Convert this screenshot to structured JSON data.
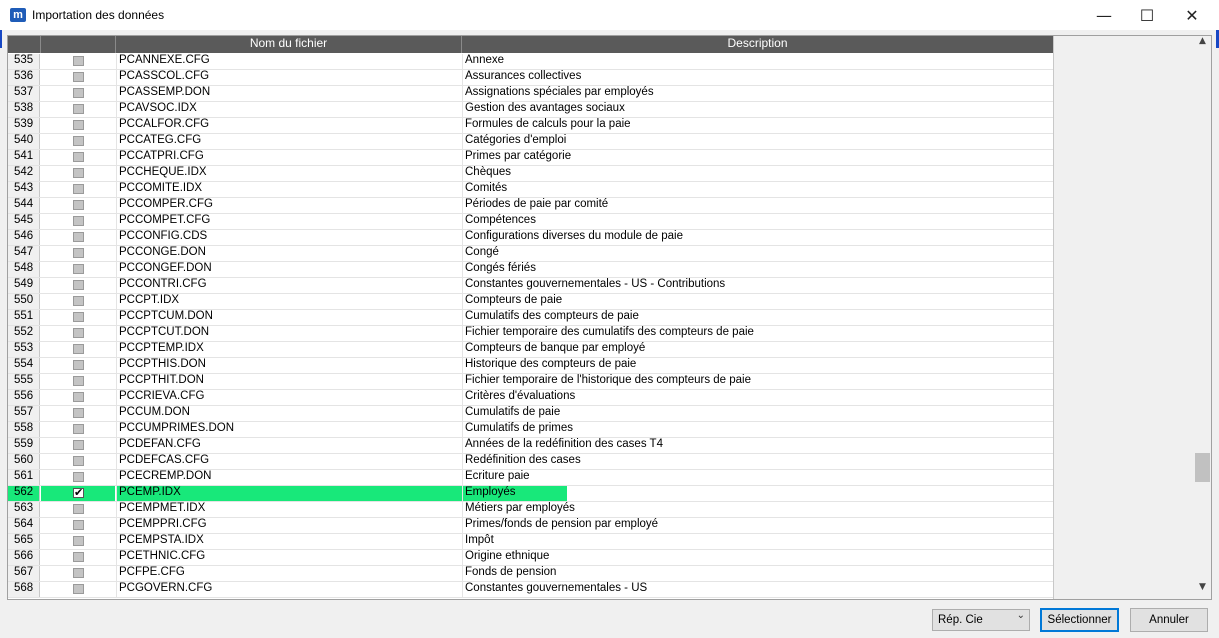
{
  "window": {
    "title": "Importation des données",
    "app_icon_letter": "m",
    "minimize": "—",
    "maximize": "☐",
    "close": "✕"
  },
  "grid": {
    "columns": {
      "filename": "Nom du fichier",
      "description": "Description"
    },
    "rows": [
      {
        "num": "535",
        "checked": false,
        "file": "PCANNEXE.CFG",
        "desc": "Annexe"
      },
      {
        "num": "536",
        "checked": false,
        "file": "PCASSCOL.CFG",
        "desc": "Assurances collectives"
      },
      {
        "num": "537",
        "checked": false,
        "file": "PCASSEMP.DON",
        "desc": "Assignations spéciales par employés"
      },
      {
        "num": "538",
        "checked": false,
        "file": "PCAVSOC.IDX",
        "desc": "Gestion des avantages sociaux"
      },
      {
        "num": "539",
        "checked": false,
        "file": "PCCALFOR.CFG",
        "desc": "Formules de calculs pour la paie"
      },
      {
        "num": "540",
        "checked": false,
        "file": "PCCATEG.CFG",
        "desc": "Catégories d'emploi"
      },
      {
        "num": "541",
        "checked": false,
        "file": "PCCATPRI.CFG",
        "desc": "Primes par catégorie"
      },
      {
        "num": "542",
        "checked": false,
        "file": "PCCHEQUE.IDX",
        "desc": "Chèques"
      },
      {
        "num": "543",
        "checked": false,
        "file": "PCCOMITE.IDX",
        "desc": "Comités"
      },
      {
        "num": "544",
        "checked": false,
        "file": "PCCOMPER.CFG",
        "desc": "Périodes de paie par comité"
      },
      {
        "num": "545",
        "checked": false,
        "file": "PCCOMPET.CFG",
        "desc": "Compétences"
      },
      {
        "num": "546",
        "checked": false,
        "file": "PCCONFIG.CDS",
        "desc": "Configurations diverses du module de paie"
      },
      {
        "num": "547",
        "checked": false,
        "file": "PCCONGE.DON",
        "desc": "Congé"
      },
      {
        "num": "548",
        "checked": false,
        "file": "PCCONGEF.DON",
        "desc": "Congés fériés"
      },
      {
        "num": "549",
        "checked": false,
        "file": "PCCONTRI.CFG",
        "desc": "Constantes gouvernementales - US - Contributions"
      },
      {
        "num": "550",
        "checked": false,
        "file": "PCCPT.IDX",
        "desc": "Compteurs de paie"
      },
      {
        "num": "551",
        "checked": false,
        "file": "PCCPTCUM.DON",
        "desc": "Cumulatifs des compteurs de paie"
      },
      {
        "num": "552",
        "checked": false,
        "file": "PCCPTCUT.DON",
        "desc": "Fichier temporaire des cumulatifs des compteurs de paie"
      },
      {
        "num": "553",
        "checked": false,
        "file": "PCCPTEMP.IDX",
        "desc": "Compteurs de banque par employé"
      },
      {
        "num": "554",
        "checked": false,
        "file": "PCCPTHIS.DON",
        "desc": "Historique des compteurs de paie"
      },
      {
        "num": "555",
        "checked": false,
        "file": "PCCPTHIT.DON",
        "desc": "Fichier temporaire de l'historique des compteurs de paie"
      },
      {
        "num": "556",
        "checked": false,
        "file": "PCCRIEVA.CFG",
        "desc": "Critères d'évaluations"
      },
      {
        "num": "557",
        "checked": false,
        "file": "PCCUM.DON",
        "desc": "Cumulatifs de paie"
      },
      {
        "num": "558",
        "checked": false,
        "file": "PCCUMPRIMES.DON",
        "desc": "Cumulatifs de primes"
      },
      {
        "num": "559",
        "checked": false,
        "file": "PCDEFAN.CFG",
        "desc": "Années de la redéfinition des cases T4"
      },
      {
        "num": "560",
        "checked": false,
        "file": "PCDEFCAS.CFG",
        "desc": "Redéfinition des cases"
      },
      {
        "num": "561",
        "checked": false,
        "file": "PCECREMP.DON",
        "desc": "Écriture paie"
      },
      {
        "num": "562",
        "checked": true,
        "selected": true,
        "file": "PCEMP.IDX",
        "desc": "Employés"
      },
      {
        "num": "563",
        "checked": false,
        "file": "PCEMPMET.IDX",
        "desc": "Métiers par employés"
      },
      {
        "num": "564",
        "checked": false,
        "file": "PCEMPPRI.CFG",
        "desc": "Primes/fonds de pension par employé"
      },
      {
        "num": "565",
        "checked": false,
        "file": "PCEMPSTA.IDX",
        "desc": "Impôt"
      },
      {
        "num": "566",
        "checked": false,
        "file": "PCETHNIC.CFG",
        "desc": "Origine ethnique"
      },
      {
        "num": "567",
        "checked": false,
        "file": "PCFPE.CFG",
        "desc": "Fonds de pension"
      },
      {
        "num": "568",
        "checked": false,
        "file": "PCGOVERN.CFG",
        "desc": "Constantes gouvernementales - US"
      }
    ],
    "selection_color": "#18e87a"
  },
  "scrollbar": {
    "up": "▲",
    "down": "▼",
    "position": 0.8
  },
  "footer": {
    "select_value": "Rép. Cie",
    "select_chevron": "⌄",
    "select_button": "Sélectionner",
    "cancel_button": "Annuler"
  }
}
